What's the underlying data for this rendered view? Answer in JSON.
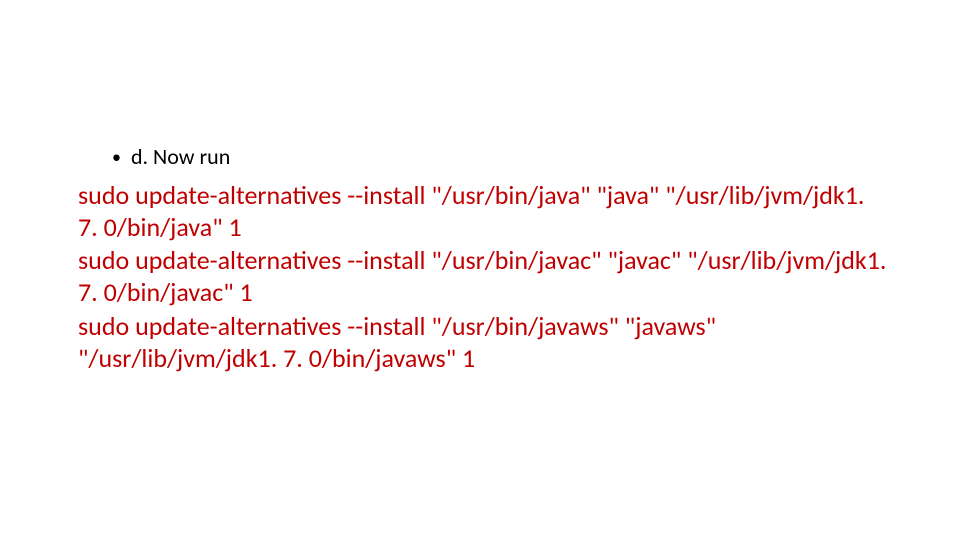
{
  "bullet": {
    "marker": "•",
    "text": "d. Now run"
  },
  "commands": {
    "line1": "sudo update-alternatives --install \"/usr/bin/java\" \"java\" \"/usr/lib/jvm/jdk1. 7. 0/bin/java\" 1",
    "line2": "sudo update-alternatives --install \"/usr/bin/javac\" \"javac\" \"/usr/lib/jvm/jdk1. 7. 0/bin/javac\" 1",
    "line3": "sudo update-alternatives --install \"/usr/bin/javaws\" \"javaws\" \"/usr/lib/jvm/jdk1. 7. 0/bin/javaws\" 1"
  }
}
